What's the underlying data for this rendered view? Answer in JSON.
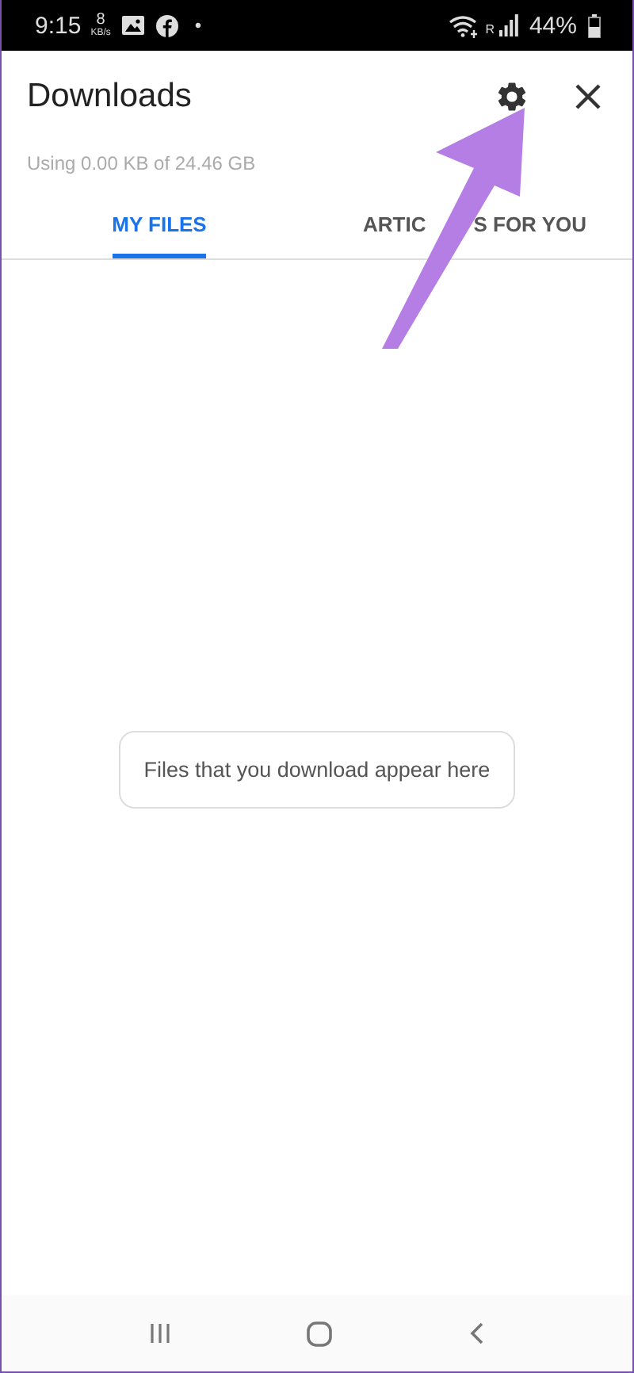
{
  "status_bar": {
    "time": "9:15",
    "speed_value": "8",
    "speed_unit": "KB/s",
    "dot": "•",
    "network_type": "R",
    "battery": "44%"
  },
  "header": {
    "title": "Downloads",
    "storage": "Using 0.00 KB of 24.46 GB"
  },
  "tabs": [
    {
      "label_parts": [
        "MY FILES"
      ],
      "selected": true
    },
    {
      "label_parts": [
        "ARTIC",
        "S FOR YOU"
      ],
      "selected": false
    }
  ],
  "empty_message": "Files that you download appear here"
}
